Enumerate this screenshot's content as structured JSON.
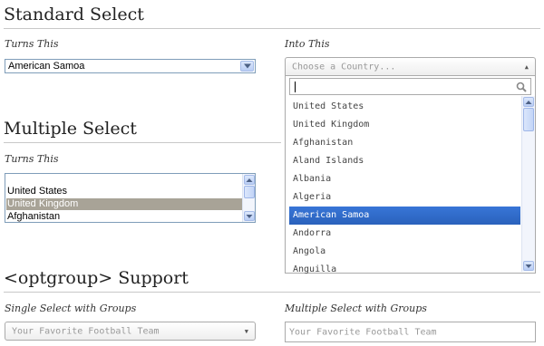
{
  "sections": {
    "standard": {
      "title": "Standard Select",
      "turns_this_label": "Turns This",
      "into_this_label": "Into This",
      "native_value": "American Samoa",
      "chosen_placeholder": "Choose a Country...",
      "search_value": "",
      "results": [
        "United States",
        "United Kingdom",
        "Afghanistan",
        "Aland Islands",
        "Albania",
        "Algeria",
        "American Samoa",
        "Andorra",
        "Angola",
        "Anguilla"
      ],
      "highlighted": "American Samoa"
    },
    "multiple": {
      "title": "Multiple Select",
      "turns_this_label": "Turns This",
      "options": [
        "United States",
        "United Kingdom",
        "Afghanistan"
      ],
      "selected": "United Kingdom"
    },
    "optgroup": {
      "title": "<optgroup> Support",
      "single_label": "Single Select with Groups",
      "single_placeholder": "Your Favorite Football Team",
      "multiple_label": "Multiple Select with Groups",
      "multiple_placeholder": "Your Favorite Football Team"
    }
  },
  "icons": {
    "dropdown_arrow": "chevron-down-icon",
    "search": "search-icon",
    "scroll_up": "scroll-up-arrow-icon",
    "scroll_down": "scroll-down-arrow-icon"
  },
  "colors": {
    "highlight": "#3875d7",
    "list_selected": "#a8a397",
    "border": "#7f9db9"
  }
}
